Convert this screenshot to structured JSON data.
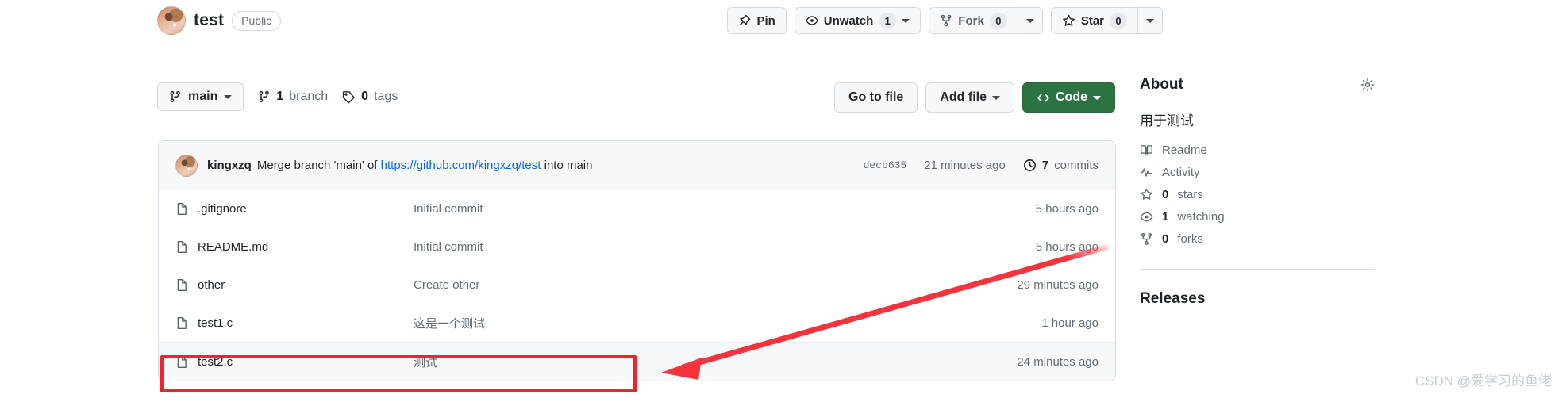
{
  "repo": {
    "name": "test",
    "visibility": "Public",
    "avatar_icon": "user-avatar"
  },
  "header_actions": {
    "pin_label": "Pin",
    "unwatch_label": "Unwatch",
    "unwatch_count": "1",
    "fork_label": "Fork",
    "fork_count": "0",
    "star_label": "Star",
    "star_count": "0"
  },
  "toolbar": {
    "branch_name": "main",
    "branch_count": "1",
    "branch_word": "branch",
    "tags_count": "0",
    "tags_word": "tags",
    "go_to_file": "Go to file",
    "add_file": "Add file",
    "code": "Code"
  },
  "commit_bar": {
    "author": "kingxzq",
    "message_prefix": "Merge branch 'main' of ",
    "message_link": "https://github.com/kingxzq/test",
    "message_suffix": " into main",
    "sha": "decb635",
    "time": "21 minutes ago",
    "commits_count": "7",
    "commits_word": "commits"
  },
  "files": [
    {
      "name": ".gitignore",
      "message": "Initial commit",
      "time": "5 hours ago"
    },
    {
      "name": "README.md",
      "message": "Initial commit",
      "time": "5 hours ago"
    },
    {
      "name": "other",
      "message": "Create other",
      "time": "29 minutes ago"
    },
    {
      "name": "test1.c",
      "message": "这是一个测试",
      "time": "1 hour ago"
    },
    {
      "name": "test2.c",
      "message": "测试",
      "time": "24 minutes ago"
    }
  ],
  "about": {
    "title": "About",
    "description": "用于测试",
    "items": [
      {
        "label": "Readme",
        "bold": "",
        "icon": "book-icon"
      },
      {
        "label": "Activity",
        "bold": "",
        "icon": "pulse-icon"
      },
      {
        "label": "stars",
        "bold": "0",
        "icon": "star-icon"
      },
      {
        "label": "watching",
        "bold": "1",
        "icon": "eye-icon"
      },
      {
        "label": "forks",
        "bold": "0",
        "icon": "fork-icon"
      }
    ],
    "releases_title": "Releases"
  },
  "annotations": {
    "highlight_color": "#f5222d",
    "arrow_color": "#f5333d"
  },
  "watermark": "CSDN @爱学习的鱼佬"
}
